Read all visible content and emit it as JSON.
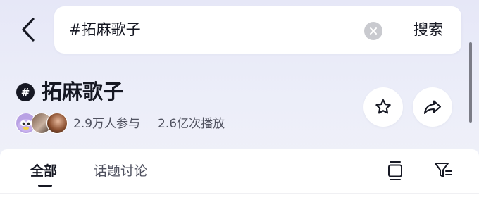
{
  "header": {
    "search_query": "#拓麻歌子",
    "search_button": "搜索"
  },
  "topic": {
    "icon_glyph": "#",
    "title": "拓麻歌子",
    "participants": "2.9万人参与",
    "plays": "2.6亿次播放"
  },
  "tabs": [
    {
      "label": "全部",
      "active": true
    },
    {
      "label": "话题讨论",
      "active": false
    }
  ],
  "colors": {
    "background": "#e6e7f7",
    "text_primary": "#161823",
    "text_secondary": "#505260"
  }
}
